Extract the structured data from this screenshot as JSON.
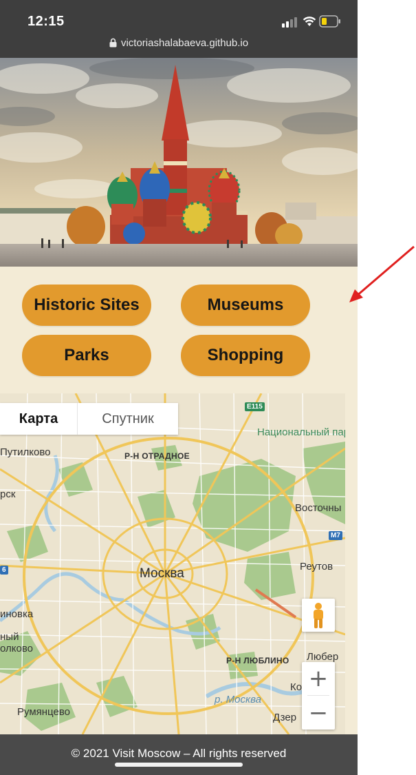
{
  "status_bar": {
    "time": "12:15"
  },
  "browser": {
    "url": "victoriashalabaeva.github.io"
  },
  "categories": [
    {
      "label": "Historic Sites"
    },
    {
      "label": "Museums"
    },
    {
      "label": "Parks"
    },
    {
      "label": "Shopping"
    }
  ],
  "map": {
    "map_type": {
      "map": "Карта",
      "satellite": "Спутник"
    },
    "labels": {
      "center": "Москва",
      "putilkovo": "Путилково",
      "otradnoe": "Р-Н ОТРАДНОЕ",
      "park": "Национальный парк « Лосиный остров»",
      "rsk": "рск",
      "vostochny": "Восточны",
      "reutov": "Реутов",
      "inovka": "иновка",
      "nyy_olkovo": "ный олково",
      "lyublino": "Р-Н ЛЮБЛИНО",
      "lyuber": "Любер",
      "ko": "Ко",
      "rumyantsevo": "Румянцево",
      "river": "р. Москва",
      "dzer": "Дзер",
      "e115": "E115",
      "m7": "M7",
      "six": "6"
    },
    "zoom_in": "+",
    "zoom_out": "−"
  },
  "footer": {
    "text": "© 2021 Visit Moscow – All rights reserved"
  },
  "colors": {
    "button": "#e29a2d",
    "background": "#f3ebd6",
    "footer": "#4a4a4a",
    "annotation_arrow": "#e0201f"
  },
  "icons": [
    "signal-icon",
    "wifi-icon",
    "battery-icon",
    "lock-icon",
    "pegman-icon",
    "annotation-arrow"
  ]
}
